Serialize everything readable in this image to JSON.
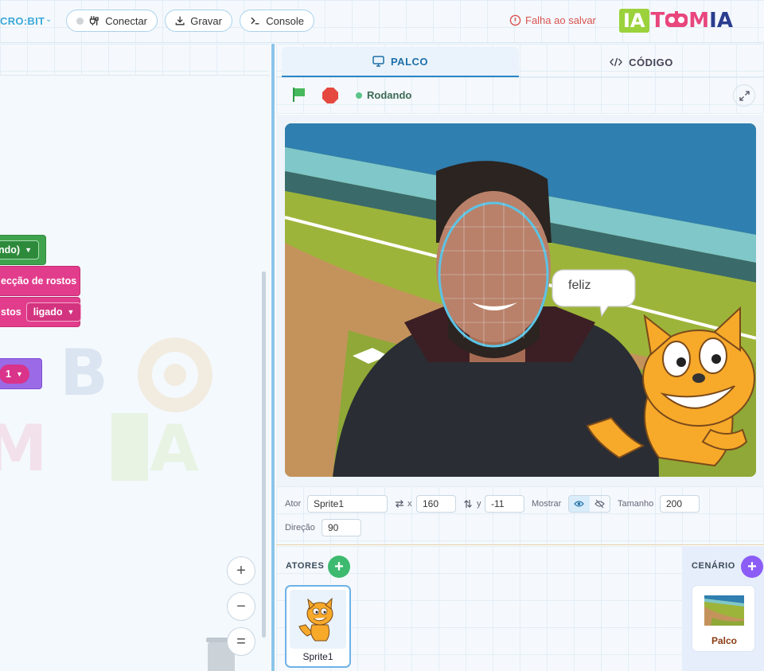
{
  "topbar": {
    "device": "CRO:BIT",
    "connect_label": "Conectar",
    "record_label": "Gravar",
    "console_label": "Console",
    "save_error": "Falha ao salvar",
    "logo_ia": "IA",
    "logo_t": "T",
    "logo_oo": "🤖",
    "logo_m": "M",
    "logo_i": "I",
    "logo_a": "A"
  },
  "blocks": {
    "b1_text": "ndo)",
    "b2_text": "ecção de rostos",
    "b3_text": "stos",
    "b3_value": "ligado",
    "b4_value": "1"
  },
  "zoom": {
    "in": "+",
    "out": "−",
    "reset": "="
  },
  "tabs": {
    "stage": "PALCO",
    "code": "CÓDIGO"
  },
  "controls": {
    "status": "Rodando"
  },
  "stage": {
    "speech": "feliz"
  },
  "sprite_props": {
    "actor_label": "Ator",
    "actor_value": "Sprite1",
    "x_label": "x",
    "x_value": "160",
    "y_label": "y",
    "y_value": "-11",
    "show_label": "Mostrar",
    "size_label": "Tamanho",
    "size_value": "200",
    "direction_label": "Direção",
    "direction_value": "90"
  },
  "sprites": {
    "title": "ATORES",
    "items": [
      {
        "name": "Sprite1"
      }
    ]
  },
  "backdrops": {
    "title": "CENÁRIO",
    "items": [
      {
        "name": "Palco"
      }
    ]
  },
  "colors": {
    "accent": "#2a86c8",
    "status_green": "#5cc48a",
    "error_red": "#d9534f",
    "sprites_add": "#3dba6f",
    "backdrops_add": "#8b5cf6"
  }
}
